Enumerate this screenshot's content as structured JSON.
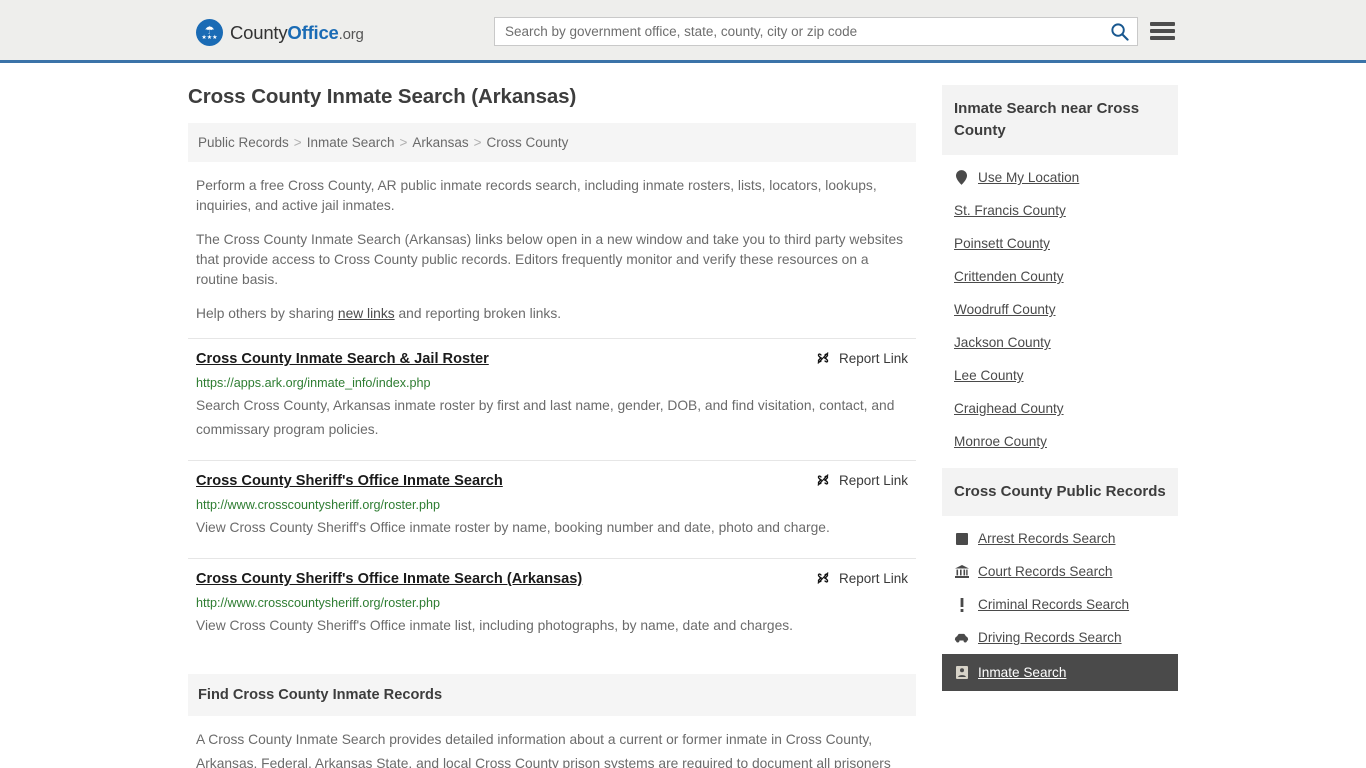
{
  "header": {
    "logo": {
      "text_part1": "County",
      "text_bold": "Office",
      "text_suffix": ".org",
      "icon": "eagle-shield-logo"
    },
    "search": {
      "placeholder": "Search by government office, state, county, city or zip code",
      "value": "",
      "icon": "search-icon"
    },
    "menu_icon": "hamburger-menu-icon"
  },
  "page": {
    "title": "Cross County Inmate Search (Arkansas)"
  },
  "breadcrumb": {
    "items": [
      {
        "label": "Public Records",
        "current": false
      },
      {
        "label": "Inmate Search",
        "current": false
      },
      {
        "label": "Arkansas",
        "current": false
      },
      {
        "label": "Cross County",
        "current": true
      }
    ],
    "separator": ">"
  },
  "intro": {
    "paragraph1": "Perform a free Cross County, AR public inmate records search, including inmate rosters, lists, locators, lookups, inquiries, and active jail inmates.",
    "paragraph2": "The Cross County Inmate Search (Arkansas) links below open in a new window and take you to third party websites that provide access to Cross County public records. Editors frequently monitor and verify these resources on a routine basis.",
    "paragraph3_before": "Help others by sharing ",
    "paragraph3_link": "new links",
    "paragraph3_after": " and reporting broken links."
  },
  "results": {
    "report_label": "Report Link",
    "report_icon": "broken-link-icon",
    "items": [
      {
        "title": "Cross County Inmate Search & Jail Roster",
        "url": "https://apps.ark.org/inmate_info/index.php",
        "description": "Search Cross County, Arkansas inmate roster by first and last name, gender, DOB, and find visitation, contact, and commissary program policies."
      },
      {
        "title": "Cross County Sheriff's Office Inmate Search",
        "url": "http://www.crosscountysheriff.org/roster.php",
        "description": "View Cross County Sheriff's Office inmate roster by name, booking number and date, photo and charge."
      },
      {
        "title": "Cross County Sheriff's Office Inmate Search (Arkansas)",
        "url": "http://www.crosscountysheriff.org/roster.php",
        "description": "View Cross County Sheriff's Office inmate list, including photographs, by name, date and charges."
      }
    ]
  },
  "find_section": {
    "heading": "Find Cross County Inmate Records",
    "body": "A Cross County Inmate Search provides detailed information about a current or former inmate in Cross County, Arkansas. Federal, Arkansas State, and local Cross County prison systems are required to document all prisoners"
  },
  "sidebar": {
    "nearby": {
      "heading": "Inmate Search near Cross County",
      "items": [
        {
          "label": "Use My Location",
          "icon": "map-pin-icon"
        },
        {
          "label": "St. Francis County",
          "icon": ""
        },
        {
          "label": "Poinsett County",
          "icon": ""
        },
        {
          "label": "Crittenden County",
          "icon": ""
        },
        {
          "label": "Woodruff County",
          "icon": ""
        },
        {
          "label": "Jackson County",
          "icon": ""
        },
        {
          "label": "Lee County",
          "icon": ""
        },
        {
          "label": "Craighead County",
          "icon": ""
        },
        {
          "label": "Monroe County",
          "icon": ""
        }
      ]
    },
    "public_records": {
      "heading": "Cross County Public Records",
      "items": [
        {
          "label": "Arrest Records Search",
          "icon": "fingerprint-icon",
          "active": false
        },
        {
          "label": "Court Records Search",
          "icon": "courthouse-icon",
          "active": false
        },
        {
          "label": "Criminal Records Search",
          "icon": "exclamation-icon",
          "active": false
        },
        {
          "label": "Driving Records Search",
          "icon": "car-icon",
          "active": false
        },
        {
          "label": "Inmate Search",
          "icon": "id-card-icon",
          "active": true
        }
      ]
    }
  },
  "colors": {
    "header_bg": "#eeeeec",
    "header_border": "#3b73a8",
    "brand_blue": "#1a6bb5",
    "url_green": "#2e7d32",
    "panel_bg": "#f3f3f3",
    "active_bg": "#4a4a4a"
  }
}
